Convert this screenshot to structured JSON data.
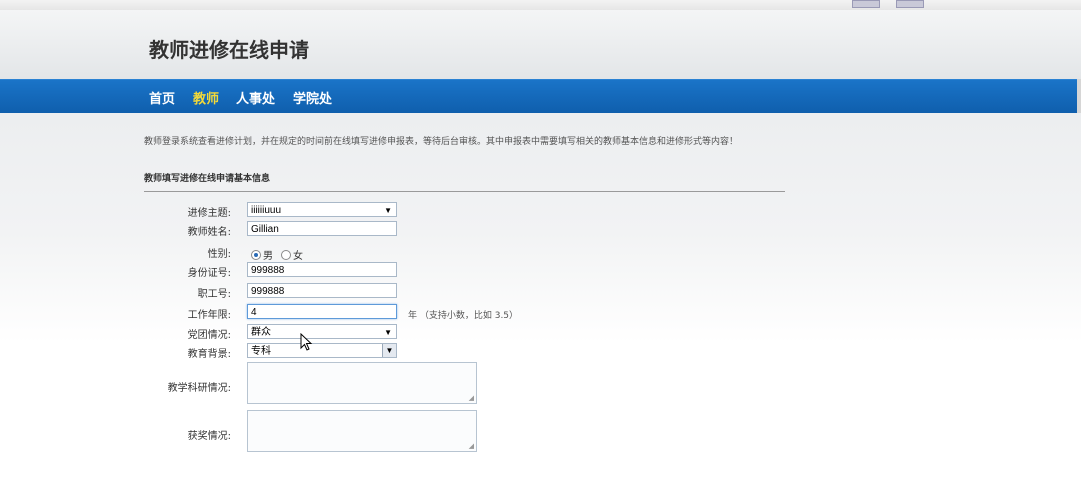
{
  "page": {
    "title": "教师进修在线申请",
    "nav": [
      "首页",
      "教师",
      "人事处",
      "学院处"
    ],
    "nav_active_index": 1,
    "intro": "教师登录系统查看进修计划，并在规定的时间前在线填写进修申报表，等待后台审核。其中申报表中需要填写相关的教师基本信息和进修形式等内容！",
    "section_heading": "教师填写进修在线申请基本信息"
  },
  "form": {
    "topic_label": "进修主题:",
    "topic_value": "iiiiiiuuu",
    "name_label": "教师姓名:",
    "name_value": "Gillian",
    "gender_label": "性别:",
    "gender_options": [
      "男",
      "女"
    ],
    "gender_selected": "男",
    "id_label": "身份证号:",
    "id_value": "999888",
    "staff_label": "职工号:",
    "staff_value": "999888",
    "years_label": "工作年限:",
    "years_value": "4",
    "years_unit_hint": "年 （支持小数，比如 3.5）",
    "party_label": "党团情况:",
    "party_value": "群众",
    "edu_label": "教育背景:",
    "edu_value": "专科",
    "research_label": "教学科研情况:",
    "research_value": "",
    "awards_label": "获奖情况:",
    "awards_value": ""
  },
  "colors": {
    "nav_bg": "#1268b9",
    "nav_active": "#f2d93a"
  },
  "icons": [
    "dropdown-arrow-icon",
    "mouse-cursor-icon",
    "resize-grip-icon"
  ]
}
